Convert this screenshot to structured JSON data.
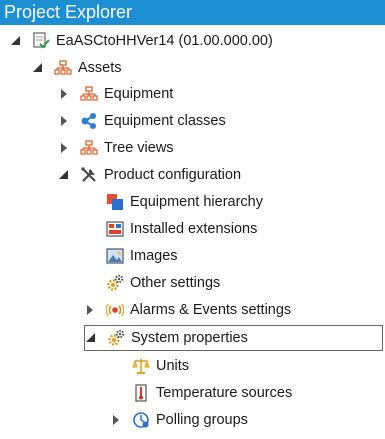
{
  "panel": {
    "title": "Project Explorer"
  },
  "tree": [
    {
      "label": "EaASCtoHHVer14 (01.00.000.00)",
      "icon": "project-check-icon",
      "state": "expanded"
    },
    {
      "label": "Assets",
      "icon": "hierarchy-icon",
      "state": "expanded"
    },
    {
      "label": "Equipment",
      "icon": "hierarchy-icon",
      "state": "collapsed"
    },
    {
      "label": "Equipment classes",
      "icon": "share-nodes-icon",
      "state": "collapsed"
    },
    {
      "label": "Tree views",
      "icon": "hierarchy-icon",
      "state": "collapsed"
    },
    {
      "label": "Product configuration",
      "icon": "tools-icon",
      "state": "expanded"
    },
    {
      "label": "Equipment hierarchy",
      "icon": "equipment-hierarchy-icon",
      "state": "none"
    },
    {
      "label": "Installed extensions",
      "icon": "extensions-icon",
      "state": "none"
    },
    {
      "label": "Images",
      "icon": "image-icon",
      "state": "none"
    },
    {
      "label": "Other settings",
      "icon": "gears-icon",
      "state": "none"
    },
    {
      "label": "Alarms & Events settings",
      "icon": "alarm-icon",
      "state": "collapsed"
    },
    {
      "label": "System properties",
      "icon": "gears-icon",
      "state": "expanded"
    },
    {
      "label": "Units",
      "icon": "scale-icon",
      "state": "none"
    },
    {
      "label": "Temperature sources",
      "icon": "thermometer-icon",
      "state": "none"
    },
    {
      "label": "Polling groups",
      "icon": "clock-icon",
      "state": "collapsed"
    }
  ],
  "colors": {
    "header_bg": "#1c8fd2",
    "header_text": "#ffffff"
  }
}
